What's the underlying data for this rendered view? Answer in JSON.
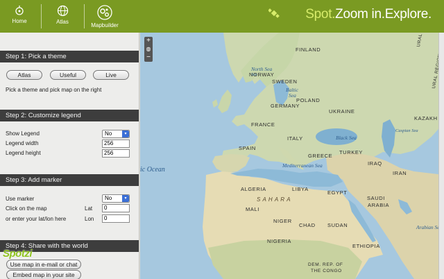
{
  "topbar": {
    "nav": [
      {
        "label": "Home",
        "icon": "target-icon"
      },
      {
        "label": "Atlas",
        "icon": "globe-icon"
      },
      {
        "label": "Mapbuilder",
        "icon": "cogs-icon"
      }
    ],
    "brand": {
      "part1": "Spot.",
      "part2": "Zoom in.",
      "part3": "Explore."
    }
  },
  "sidebar": {
    "step1": {
      "title": "Step 1: Pick a theme",
      "buttons": [
        "Atlas",
        "Useful",
        "Live"
      ],
      "hint": "Pick a theme and pick map on the right"
    },
    "step2": {
      "title": "Step 2: Customize legend",
      "show_legend_label": "Show Legend",
      "show_legend_value": "No",
      "width_label": "Legend width",
      "width_value": "256",
      "height_label": "Legend height",
      "height_value": "256"
    },
    "step3": {
      "title": "Step 3: Add marker",
      "use_marker_label": "Use marker",
      "use_marker_value": "No",
      "click_label": "Click on the map",
      "lat_label": "Lat",
      "lat_value": "0",
      "enter_label": "or enter your lat/lon here",
      "lon_label": "Lon",
      "lon_value": "0"
    },
    "step4": {
      "title": "Step 4: Share with the world",
      "button1": "Use map in e-mail or chat",
      "button2": "Embed map in your site"
    },
    "logo": "Spotzi"
  },
  "map": {
    "zoom_in": "+",
    "zoom_out": "−",
    "labels": {
      "finland": "FINLAND",
      "norway": "NORWAY",
      "sweden": "SWEDEN",
      "north_sea": "North Sea",
      "baltic": "Baltic",
      "baltic2": "Sea",
      "ural": "URAL MOUNTAINS",
      "ural2": "URAL REGION",
      "poland": "POLAND",
      "ukraine": "UKRAINE",
      "germany": "GERMANY",
      "france": "FRANCE",
      "kazakh": "KAZAKH",
      "black_sea": "Black Sea",
      "caspian": "Caspian Sea",
      "spain": "SPAIN",
      "italy": "ITALY",
      "greece": "GREECE",
      "turkey": "TURKEY",
      "med": "Mediterranean Sea",
      "ocean": "ic Ocean",
      "iraq": "IRAQ",
      "iran": "IRAN",
      "algeria": "ALGERIA",
      "libya": "LIBYA",
      "egypt": "EGYPT",
      "saudi": "SAUDI",
      "arabia": "ARABIA",
      "sahara": "S A H A R A",
      "mali": "MALI",
      "niger": "NIGER",
      "chad": "CHAD",
      "sudan": "SUDAN",
      "arabian_sea": "Arabian Sea",
      "nigeria": "NIGERIA",
      "ethiopia": "ETHIOPIA",
      "drc1": "DEM. REP. OF",
      "drc2": "THE CONGO"
    }
  }
}
